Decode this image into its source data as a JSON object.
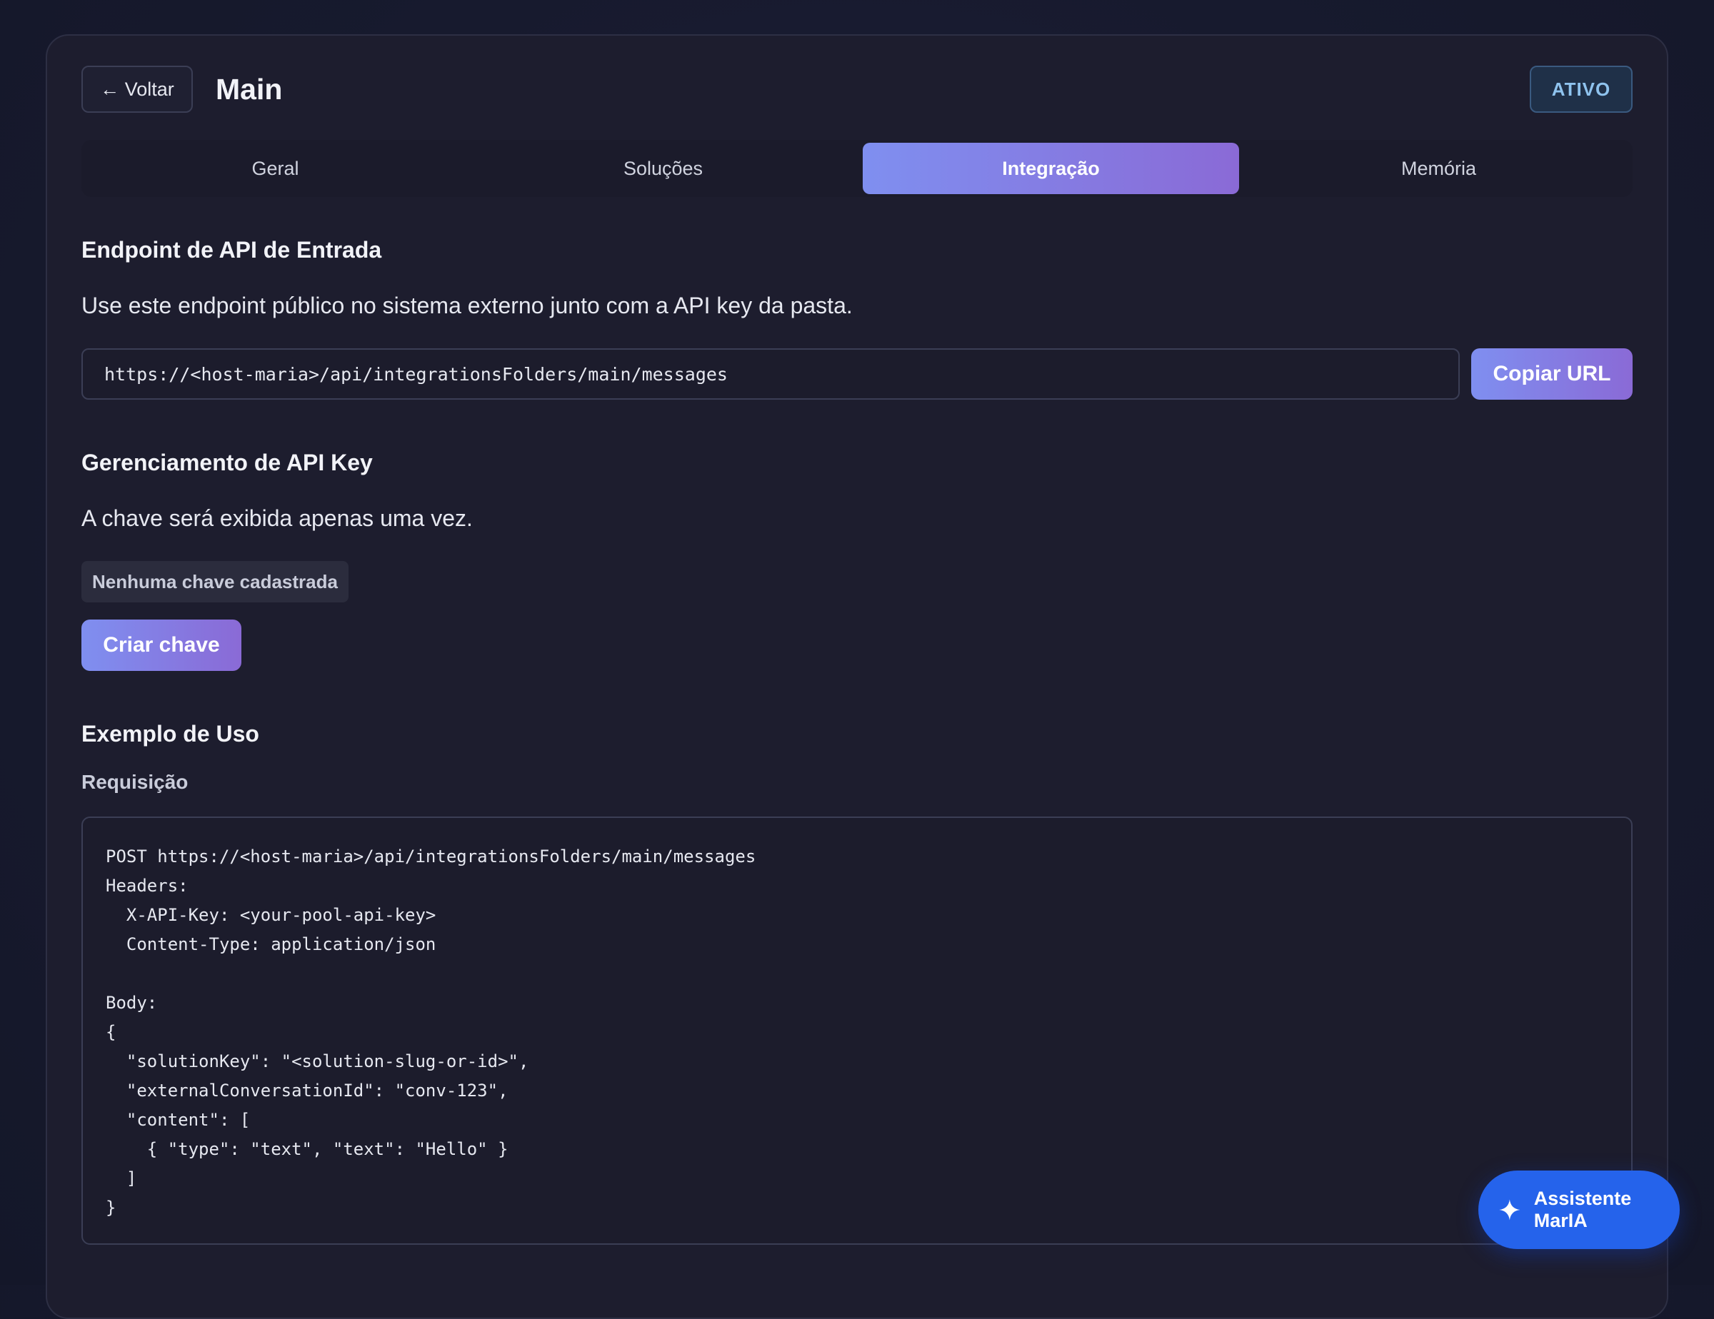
{
  "header": {
    "back_label": "← Voltar",
    "title": "Main",
    "status": "ATIVO"
  },
  "tabs": [
    {
      "label": "Geral",
      "active": false
    },
    {
      "label": "Soluções",
      "active": false
    },
    {
      "label": "Integração",
      "active": true
    },
    {
      "label": "Memória",
      "active": false
    }
  ],
  "endpoint": {
    "title": "Endpoint de API de Entrada",
    "description": "Use este endpoint público no sistema externo junto com a API key da pasta.",
    "url": "https://<host-maria>/api/integrationsFolders/main/messages",
    "copy_label": "Copiar URL"
  },
  "api_key": {
    "title": "Gerenciamento de API Key",
    "description": "A chave será exibida apenas uma vez.",
    "status_chip": "Nenhuma chave cadastrada",
    "create_label": "Criar chave"
  },
  "example": {
    "title": "Exemplo de Uso",
    "request_label": "Requisição",
    "code_lines": [
      "POST https://<host-maria>/api/integrationsFolders/main/messages",
      "Headers:",
      "  X-API-Key: <your-pool-api-key>",
      "  Content-Type: application/json",
      "",
      "Body:",
      "{",
      "  \"solutionKey\": \"<solution-slug-or-id>\",",
      "  \"externalConversationId\": \"conv-123\",",
      "  \"content\": [",
      "    { \"type\": \"text\", \"text\": \"Hello\" }",
      "  ]",
      "}"
    ]
  },
  "assistant": {
    "label": "Assistente MarIA",
    "icon": "sparkle-icon"
  },
  "colors": {
    "accent_gradient_start": "#7f8ff0",
    "accent_gradient_end": "#8a6ad6",
    "assistant_blue": "#2563eb",
    "status_text": "#8fc3ee"
  }
}
